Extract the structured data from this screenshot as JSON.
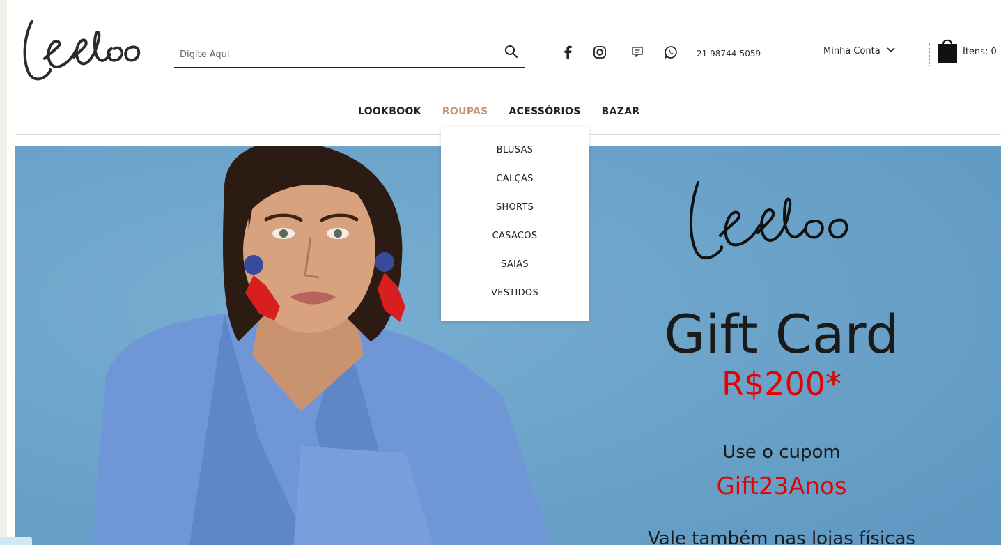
{
  "brand": {
    "logo_text": "leeloo"
  },
  "search": {
    "placeholder": "Digite Aqui"
  },
  "social": {
    "icons": [
      "facebook-icon",
      "instagram-icon",
      "chat-icon",
      "whatsapp-icon"
    ]
  },
  "contact": {
    "phone": "21 98744-5059"
  },
  "account": {
    "label": "Minha Conta"
  },
  "cart": {
    "label": "Itens: 0"
  },
  "nav": {
    "items": [
      {
        "label": "LOOKBOOK",
        "active": false
      },
      {
        "label": "ROUPAS",
        "active": true
      },
      {
        "label": "ACESSÓRIOS",
        "active": false
      },
      {
        "label": "BAZAR",
        "active": false
      }
    ]
  },
  "dropdown": {
    "items": [
      "BLUSAS",
      "CALÇAS",
      "SHORTS",
      "CASACOS",
      "SAIAS",
      "VESTIDOS"
    ]
  },
  "hero": {
    "logo_text": "leeloo",
    "title": "Gift Card",
    "price": "R$200*",
    "coupon_label": "Use o cupom",
    "coupon_code": "Gift23Anos",
    "footnote": "Vale também nas lojas físicas"
  },
  "colors": {
    "accent": "#c8957a",
    "hero_bg": "#6aa2c9",
    "price_red": "#e60000"
  }
}
